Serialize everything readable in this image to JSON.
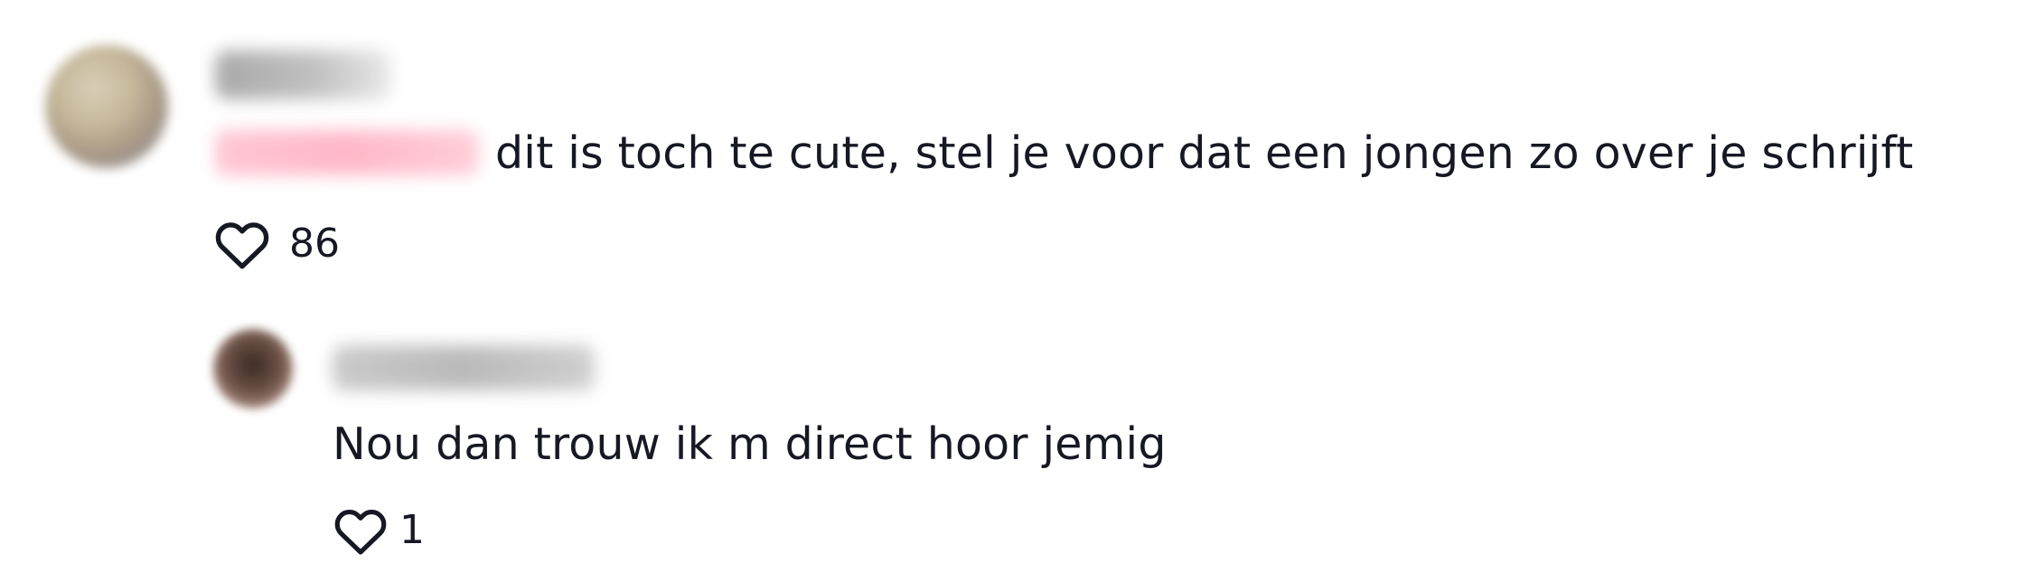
{
  "comments": [
    {
      "author": "Rosse",
      "mention": "@Obesitess",
      "text": "dit is toch te cute, stel je voor dat een jongen zo over je schrijft",
      "likes": "86",
      "like_icon": "heart-outline-icon"
    }
  ],
  "reply": {
    "author": "Obesitess",
    "text": "Nou dan trouw ik m direct hoor jemig",
    "likes": "1",
    "like_icon": "heart-outline-icon"
  },
  "colors": {
    "text": "#161823",
    "mention": "#fe2c55"
  }
}
